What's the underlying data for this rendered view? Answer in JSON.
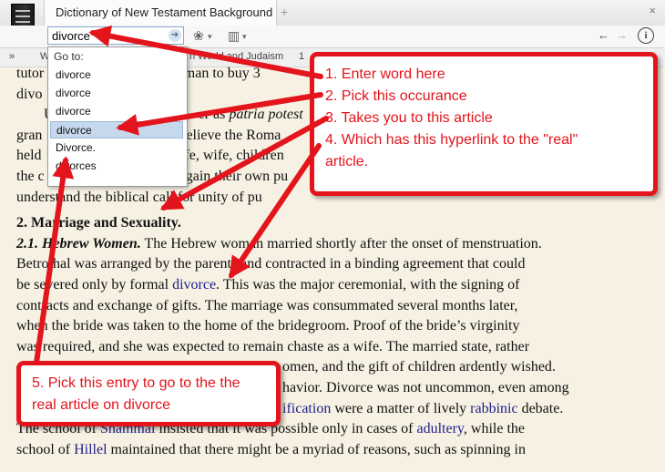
{
  "window": {
    "tab_title": "Dictionary of New Testament Background",
    "add_tab_symbol": "+",
    "close_symbol": "×"
  },
  "toolbar": {
    "search_value": "divorce",
    "nav_back": "←",
    "nav_forward": "→",
    "info_symbol": "i"
  },
  "breadcrumb": {
    "chevron": "»",
    "part_a": "W",
    "part_b": "n World and Judaism",
    "part_c": "1"
  },
  "dropdown": {
    "header": "Go to:",
    "items": [
      "divorce",
      "divorce",
      "divorce",
      "divorce",
      "Divorce.",
      "divorces"
    ],
    "selected_index": 3
  },
  "article": {
    "line1": "tutor",
    "line1b": "woman to buy 3",
    "line2": "divo",
    "line3a": "U",
    "line3b": "er as ",
    "line3c": "patria potest",
    "line4a": "gran",
    "line4b": "believe the Roma",
    "line5a": "held",
    "line5b": "life, wife, children",
    "line6a": "the c",
    "line6b": "again their own pu",
    "line7": "understand the biblical call for unity of pu",
    "heading": "2. Marriage and Sexuality.",
    "sub_label": "2.1. Hebrew Women.",
    "p1_rest": " The Hebrew woman married shortly after the onset of menstruation.",
    "p2": "Betrothal was arranged by the parents and contracted in a binding agreement that could",
    "p3a": "be severed only by formal ",
    "p3_link": "divorce",
    "p3b": ". This was the major ceremonial, with the signing of",
    "p4": "contracts and exchange of gifts. The marriage was consummated several months later,",
    "p5": "when the bride was taken to the home of the bridegroom. Proof of the bride’s virginity",
    "p6": "was required, and she was expected to remain chaste as a wife. The married state, rather",
    "p7": "omen, and the gift of children ardently wished.",
    "p8": "havior. Divorce was not uncommon, even among",
    "p9_link1": "ification",
    "p9_mid": " were a matter of lively ",
    "p9_link2": "rabbinic",
    "p9_end": " debate.",
    "p10a": "The school of ",
    "p10_link1": "Shammai",
    "p10b": " insisted that it was possible only in cases of ",
    "p10_link2": "adultery",
    "p10c": ", while the",
    "p11a": "school of ",
    "p11_link": "Hillel",
    "p11b": " maintained that there might be a myriad of reasons, such as spinning in"
  },
  "callouts": {
    "main": [
      "1. Enter word here",
      "2. Pick this occurance",
      "3. Takes you to this article",
      "4. Which has this hyperlink to the \"real\"",
      "article."
    ],
    "bottom": "5. Pick this entry to go to the the real article on divorce"
  },
  "colors": {
    "annotation_red": "#e3141c",
    "link_blue": "#1d1d8a",
    "page_background": "#f6f1e3"
  }
}
